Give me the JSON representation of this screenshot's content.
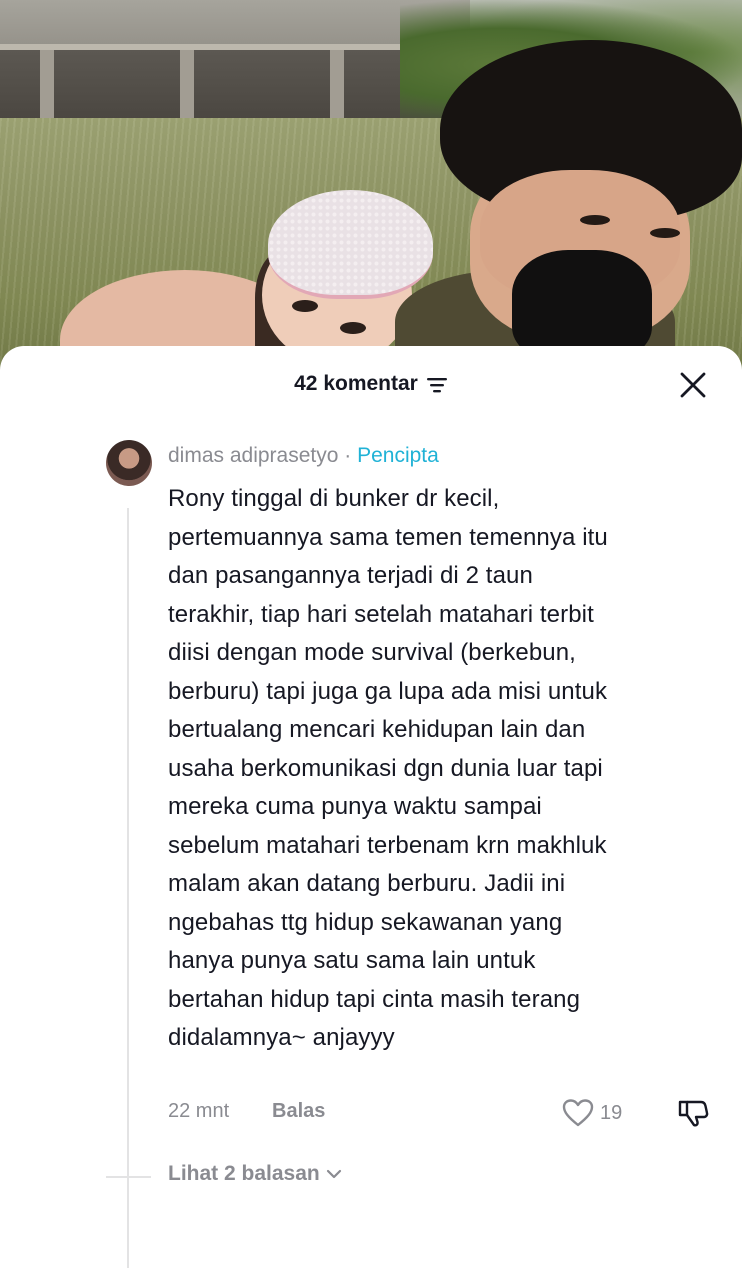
{
  "header": {
    "comment_count_label": "42 komentar"
  },
  "comment": {
    "username": "dimas adiprasetyo",
    "separator": " · ",
    "badge": "Pencipta",
    "text_lines": [
      "Rony tinggal di bunker dr kecil,",
      "pertemuannya sama temen temennya itu",
      "dan pasangannya terjadi di 2 taun",
      "terakhir, tiap hari setelah matahari terbit",
      "diisi dengan mode survival (berkebun,",
      "berburu) tapi juga ga lupa ada misi untuk",
      "bertualang mencari kehidupan lain dan",
      "usaha berkomunikasi dgn dunia luar tapi",
      "mereka cuma punya waktu sampai",
      "sebelum matahari terbenam krn makhluk",
      "malam akan datang berburu. Jadii ini",
      "ngebahas ttg hidup sekawanan yang",
      "hanya punya satu sama lain untuk",
      "bertahan hidup tapi cinta masih terang",
      "didalamnya~ anjayyy"
    ],
    "timestamp": "22 mnt",
    "reply_label": "Balas",
    "like_count": "19",
    "view_replies_label": "Lihat 2 balasan"
  },
  "colors": {
    "creator_badge": "#20b2d6",
    "text_primary": "#161823",
    "text_secondary": "#8a8b91"
  },
  "icons": {
    "filter": "filter-icon",
    "close": "close-icon",
    "like": "heart-outline-icon",
    "dislike": "thumbs-down-icon",
    "expand": "chevron-down-icon"
  }
}
